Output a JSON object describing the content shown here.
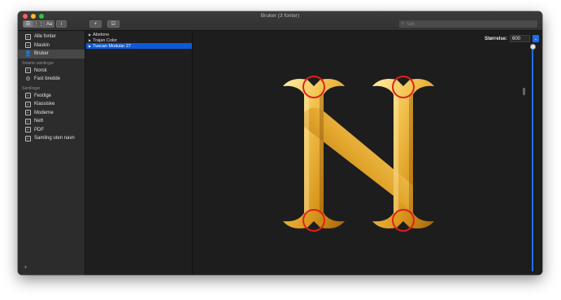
{
  "window": {
    "title": "Bruker (3 fonter)"
  },
  "toolbar": {
    "view_buttons": [
      "☰",
      "⋮⋮",
      "Aa"
    ],
    "info_label": "i",
    "add_label": "+",
    "validate_label": "☑",
    "search_placeholder": "Søk",
    "search_value": ""
  },
  "sidebar": {
    "library_items": [
      {
        "label": "Alle fonter",
        "icon": "font-book-icon"
      },
      {
        "label": "Maskin",
        "icon": "computer-icon"
      },
      {
        "label": "Bruker",
        "icon": "user-icon",
        "selected": true
      }
    ],
    "smart_header": "Smarte samlinger",
    "smart_items": [
      {
        "label": "Norsk",
        "icon": "font-book-icon"
      },
      {
        "label": "Fast bredde",
        "icon": "gear-icon"
      }
    ],
    "collections_header": "Samlinger",
    "collection_items": [
      {
        "label": "Festlige",
        "icon": "collection-icon"
      },
      {
        "label": "Klassiske",
        "icon": "collection-icon"
      },
      {
        "label": "Moderne",
        "icon": "collection-icon"
      },
      {
        "label": "Nett",
        "icon": "collection-icon"
      },
      {
        "label": "PDF",
        "icon": "collection-icon"
      },
      {
        "label": "Samling uten navn",
        "icon": "collection-icon"
      }
    ],
    "add_label": "+"
  },
  "fonts": [
    {
      "label": "Abelone",
      "selected": false
    },
    {
      "label": "Trajan Color",
      "selected": false
    },
    {
      "label": "Tuscan Modular 27",
      "selected": true
    }
  ],
  "preview": {
    "size_label": "Størrelse:",
    "size_value": "600",
    "glyph": "N",
    "size_slider_fraction": 1.0
  },
  "colors": {
    "selection": "#0b5ad8",
    "glyph_gold": "#f2c14e",
    "marker_red": "#e0201b"
  }
}
